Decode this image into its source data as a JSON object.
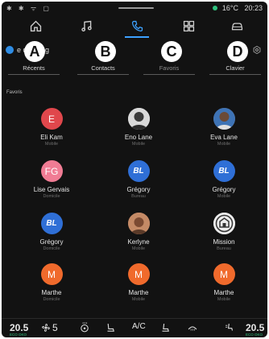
{
  "status": {
    "left_icons": "✱ ✱ ᯤ ▢",
    "temperature": "16°C",
    "time": "20:23"
  },
  "nav": {
    "items": [
      {
        "icon": "home-icon"
      },
      {
        "icon": "music-icon"
      },
      {
        "icon": "phone-icon"
      },
      {
        "icon": "apps-icon"
      },
      {
        "icon": "car-icon"
      }
    ],
    "active": "phone-icon"
  },
  "phone": {
    "profile_name": "e de Greg",
    "tabs": [
      {
        "letter": "A",
        "label": "Récents"
      },
      {
        "letter": "B",
        "label": "Contacts"
      },
      {
        "letter": "C",
        "label": "Favoris"
      },
      {
        "letter": "D",
        "label": "Clavier"
      }
    ],
    "section_label": "Favoris"
  },
  "contacts": [
    {
      "name": "Eli Kam",
      "sub": "Mobile",
      "avatar_text": "E",
      "avatar_color": "#e0474c"
    },
    {
      "name": "Eno Lane",
      "sub": "Mobile",
      "avatar_text": "",
      "avatar_color": "#dcdcdc"
    },
    {
      "name": "Eva Lane",
      "sub": "Mobile",
      "avatar_text": "",
      "avatar_color": "#7a5a45"
    },
    {
      "name": "Lise Gervais",
      "sub": "Domicile",
      "avatar_text": "FG",
      "avatar_color": "#f07c94"
    },
    {
      "name": "Grégory",
      "sub": "Bureau",
      "avatar_text": "BL",
      "avatar_color": "#2f6fd6"
    },
    {
      "name": "Grégory",
      "sub": "Mobile",
      "avatar_text": "BL",
      "avatar_color": "#2f6fd6"
    },
    {
      "name": "Grégory",
      "sub": "Domicile",
      "avatar_text": "BL",
      "avatar_color": "#2f6fd6"
    },
    {
      "name": "Kerlyne",
      "sub": "Mobile",
      "avatar_text": "",
      "avatar_color": "#b87a5a"
    },
    {
      "name": "Mission",
      "sub": "Bureau",
      "avatar_text": "",
      "avatar_color": "#e9e9e9"
    },
    {
      "name": "Marthe",
      "sub": "Domicile",
      "avatar_text": "M",
      "avatar_color": "#f06a2c"
    },
    {
      "name": "Marthe",
      "sub": "Mobile",
      "avatar_text": "M",
      "avatar_color": "#f06a2c"
    },
    {
      "name": "Marthe",
      "sub": "Mobile",
      "avatar_text": "M",
      "avatar_color": "#f06a2c"
    }
  ],
  "bottom": {
    "temp_left": "20.5",
    "temp_left_sub": "ECO OKO",
    "fan_level": "5",
    "ac_label": "A/C",
    "temp_right": "20.5",
    "temp_right_sub": "ECO OKO"
  },
  "colors": {
    "accent": "#3da1ff",
    "status_green": "#2ec27e"
  }
}
